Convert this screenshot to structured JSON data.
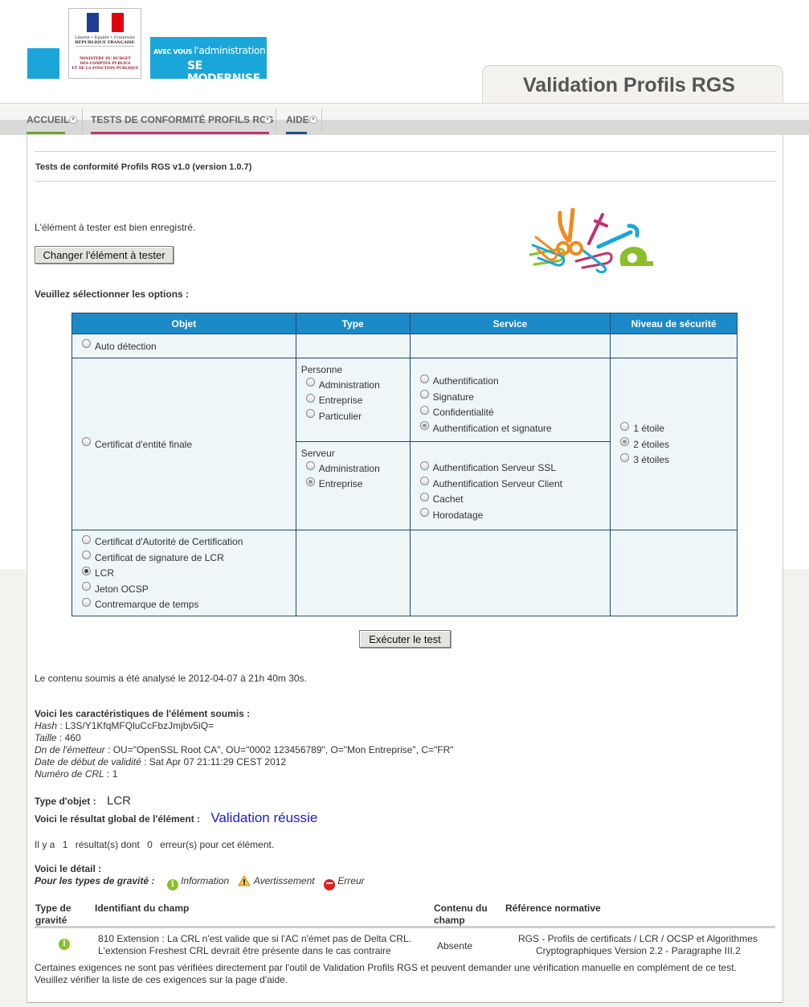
{
  "header": {
    "republique_line1": "Liberté • Égalité • Fraternité",
    "republique_line2": "RÉPUBLIQUE FRANÇAISE",
    "ministere_line1": "MINISTÈRE DU BUDGET",
    "ministere_line2": "DES COMPTES PUBLICS",
    "ministere_line3": "ET DE LA FONCTION PUBLIQUE",
    "modernise_small": "AVEC VOUS",
    "modernise_line1": "l'administration",
    "modernise_line2": "SE MODERNISE",
    "app_title": "Validation Profils RGS"
  },
  "menu": {
    "items": [
      {
        "label": "ACCUEIL",
        "color": "#6ba539"
      },
      {
        "label": "TESTS DE CONFORMITÉ PROFILS RGS",
        "color": "#c0326e"
      },
      {
        "label": "AIDE",
        "color": "#1f4f8f"
      }
    ]
  },
  "main": {
    "page_heading": "Tests de conformité Profils RGS v1.0 (version 1.0.7)",
    "status_message": "L'élément à tester est bien enregistré.",
    "change_button": "Changer l'élément à tester",
    "options_label": "Veuillez sélectionner les options :",
    "table": {
      "headers": [
        "Objet",
        "Type",
        "Service",
        "Niveau de sécurité"
      ],
      "auto_detection": "Auto détection",
      "entity_certificate": "Certificat d'entité finale",
      "personne_title": "Personne",
      "personne_options": [
        "Administration",
        "Entreprise",
        "Particulier"
      ],
      "personne_services": [
        "Authentification",
        "Signature",
        "Confidentialité",
        "Authentification et signature"
      ],
      "serveur_title": "Serveur",
      "serveur_options": [
        "Administration",
        "Entreprise"
      ],
      "serveur_services": [
        "Authentification Serveur SSL",
        "Authentification Serveur Client",
        "Cachet",
        "Horodatage"
      ],
      "levels": [
        "1 étoile",
        "2 étoiles",
        "3 étoiles"
      ],
      "other_objects": [
        "Certificat d'Autorité de Certification",
        "Certificat de signature de LCR",
        "LCR",
        "Jeton OCSP",
        "Contremarque de temps"
      ]
    },
    "execute_button": "Exécuter le test",
    "analysis_text": "Le contenu soumis a été analysé le 2012-04-07 à 21h 40m 30s.",
    "characteristics_title": "Voici les caractéristiques de l'élément soumis :",
    "characteristics": [
      {
        "key": "Hash",
        "value": "L3S/Y1KfqMFQluCcFbzJmjbv5iQ="
      },
      {
        "key": "Taille",
        "value": "460"
      },
      {
        "key": "Dn de l'émetteur",
        "value": "OU=\"OpenSSL Root CA\", OU=\"0002 123456789\", O=\"Mon Entreprise\", C=\"FR\""
      },
      {
        "key": "Date de début de validité",
        "value": "Sat Apr 07 21:11:29 CEST 2012"
      },
      {
        "key": "Numéro de CRL",
        "value": "1"
      }
    ],
    "object_type_label": "Type d'objet :",
    "object_type_value": "LCR",
    "global_result_label": "Voici le résultat global de l'élément :",
    "global_result_value": "Validation réussie",
    "count_text": {
      "p1": "Il y a",
      "results": "1",
      "p2": "résultat(s) dont",
      "errors": "0",
      "p3": "erreur(s) pour cet élément."
    },
    "detail_title": "Voici le détail :",
    "severity_label": "Pour les types de gravité :",
    "severities": {
      "information": "Information",
      "warning": "Avertissement",
      "error": "Erreur"
    },
    "results_headers": {
      "type": "Type de gravité",
      "field": "Identifiant du champ",
      "content": "Contenu du champ",
      "reference": "Référence normative"
    },
    "results_row": {
      "field_line1": "810 Extension : La CRL n'est valide que si l'AC n'émet pas de Delta CRL.",
      "field_line2": "L'extension Freshest CRL devrait être présente dans le cas contraire",
      "content": "Absente",
      "reference_line1": "RGS - Profils de certificats / LCR / OCSP et Algorithmes",
      "reference_line2": "Cryptographiques Version 2.2 - Paragraphe III.2"
    },
    "footnote_line1": "Certaines exigences ne sont pas vérifiées directement par l'outil de Validation Profils RGS et peuvent demander une vérification manuelle en complément de ce test.",
    "footnote_line2": "Veuillez vérifier la liste de ces exigences sur la page d'aide."
  },
  "colors": {
    "brand_blue": "#1aa6d9",
    "table_header": "#1d8ac8",
    "result_ok": "#1a1adc",
    "info_icon": "#8bbf2a"
  }
}
